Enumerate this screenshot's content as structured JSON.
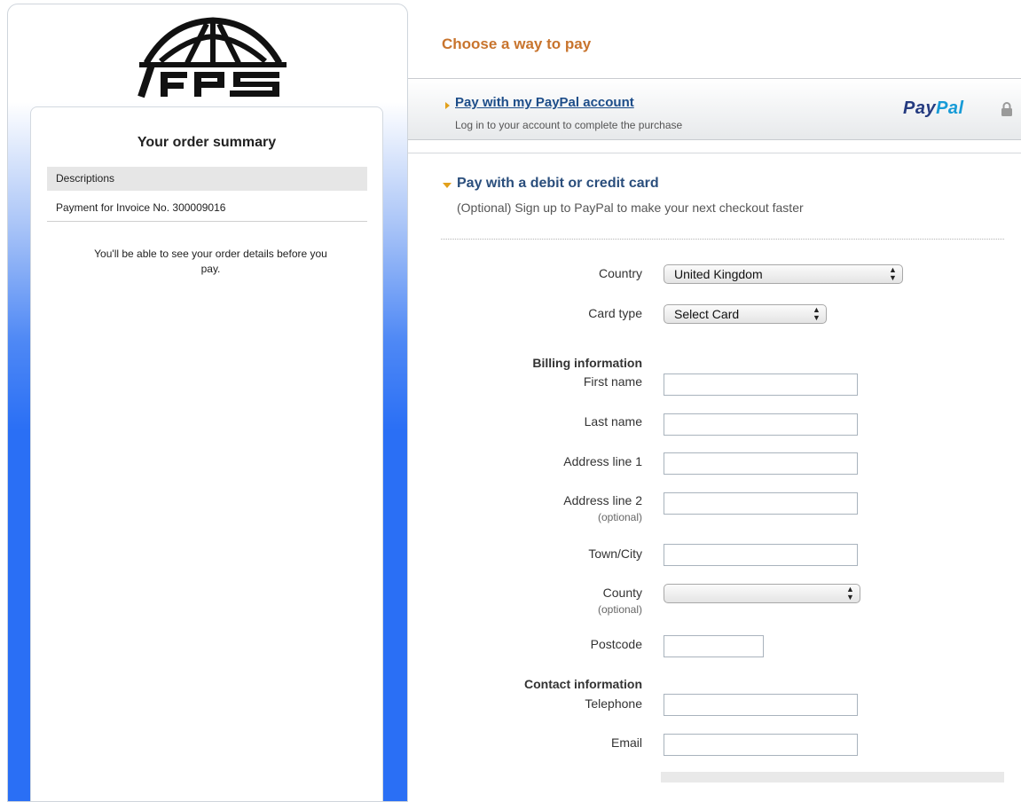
{
  "sidebar": {
    "order_summary_title": "Your order summary",
    "descriptions_header": "Descriptions",
    "description_row": "Payment for Invoice No. 300009016",
    "order_note": "You'll be able to see your order details before you pay."
  },
  "main": {
    "title": "Choose a way to pay",
    "paypal_option": {
      "link": "Pay with my PayPal account",
      "subtitle": "Log in to your account to complete the purchase",
      "brand_pay": "Pay",
      "brand_pal": "Pal"
    },
    "card_option": {
      "title": "Pay with a debit or credit card",
      "subtitle": "(Optional) Sign up to PayPal to make your next checkout faster"
    },
    "form": {
      "country_label": "Country",
      "country_value": "United Kingdom",
      "card_type_label": "Card type",
      "card_type_value": "Select Card",
      "billing_heading": "Billing information",
      "first_name_label": "First name",
      "last_name_label": "Last name",
      "address1_label": "Address line 1",
      "address2_label": "Address line 2",
      "optional_note": "(optional)",
      "town_label": "Town/City",
      "county_label": "County",
      "county_value": "",
      "postcode_label": "Postcode",
      "contact_heading": "Contact information",
      "telephone_label": "Telephone",
      "email_label": "Email"
    }
  },
  "colors": {
    "accent_orange": "#c8742d",
    "link_blue": "#1d4d89",
    "paypal_dark": "#253b80",
    "paypal_light": "#179bd7",
    "sidebar_blue": "#2a6ff5"
  }
}
